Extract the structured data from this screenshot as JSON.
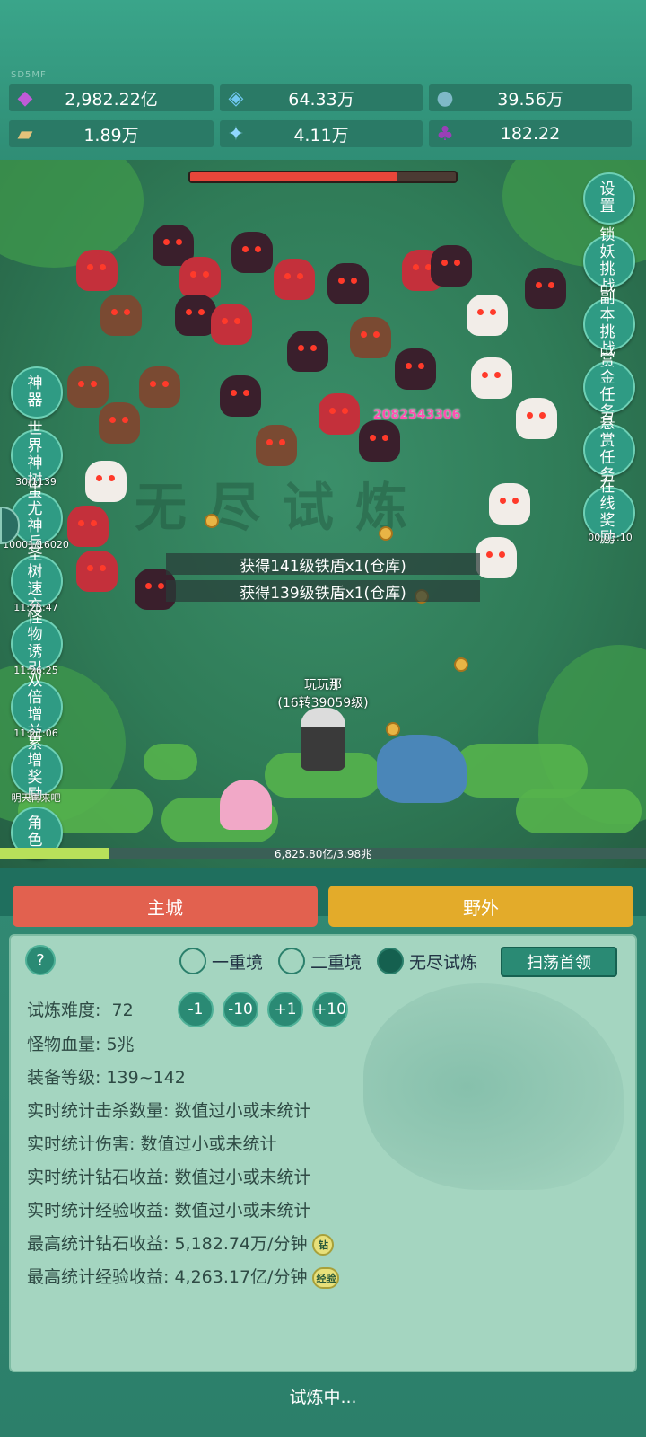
{
  "status_bar": {
    "ping": "SD5MF"
  },
  "resources": [
    {
      "icon": "purple-gem-icon",
      "value": "2,982.22亿"
    },
    {
      "icon": "blue-crystal-icon",
      "value": "64.33万"
    },
    {
      "icon": "orb-icon",
      "value": "39.56万"
    },
    {
      "icon": "scroll-icon",
      "value": "1.89万"
    },
    {
      "icon": "ice-shard-icon",
      "value": "4.11万"
    },
    {
      "icon": "potion-icon",
      "value": "182.22"
    }
  ],
  "battle": {
    "damage_number": "2082543306",
    "loot_messages": [
      "获得141级铁盾x1(仓库)",
      "获得139级铁盾x1(仓库)"
    ],
    "watermark": "无尽试炼",
    "player_name": "玩玩那",
    "player_level": "(16转39059级)",
    "boss_hp_fraction": 0.78,
    "exp_text": "6,825.80亿/3.98兆",
    "exp_fraction": 0.17
  },
  "left_buttons": [
    {
      "label": "神器",
      "timer": ""
    },
    {
      "label": "世界神树",
      "timer": "30/1139"
    },
    {
      "label": "蚩尤神兵",
      "timer": "10001/16020"
    },
    {
      "label": "圣树速充",
      "timer": "11:25:47"
    },
    {
      "label": "怪物诱引",
      "timer": "11:26:25"
    },
    {
      "label": "双倍增益",
      "timer": "11:27:06"
    },
    {
      "label": "累增奖励",
      "timer": "明天再来吧"
    },
    {
      "label": "角色",
      "timer": ""
    }
  ],
  "right_buttons": [
    {
      "label": "设置",
      "timer": ""
    },
    {
      "label": "锁妖挑战",
      "timer": ""
    },
    {
      "label": "副本挑战",
      "timer": ""
    },
    {
      "label": "赏金任务",
      "timer": ""
    },
    {
      "label": "悬赏任务",
      "timer": ""
    },
    {
      "label": "在线奖励",
      "timer": "00:03:10"
    }
  ],
  "tabs": {
    "main_city": "主城",
    "wild": "野外"
  },
  "colors": {
    "main_city": "#e2614f",
    "wild": "#e3ab2a"
  },
  "panel": {
    "help": "?",
    "modes": [
      "一重境",
      "二重境",
      "无尽试炼"
    ],
    "selected_mode": "无尽试炼",
    "sweep_button": "扫荡首领",
    "difficulty_label": "试炼难度:",
    "difficulty_value": "72",
    "adjust_buttons": [
      "-1",
      "-10",
      "+1",
      "+10"
    ],
    "lines": [
      "怪物血量:  5兆",
      "装备等级:  139~142",
      "实时统计击杀数量:  数值过小或未统计",
      "实时统计伤害:  数值过小或未统计",
      "实时统计钻石收益:  数值过小或未统计",
      "实时统计经验收益:  数值过小或未统计"
    ],
    "best_diamond": "最高统计钻石收益:  5,182.74万/分钟",
    "best_diamond_badge": "钻",
    "best_exp": "最高统计经验收益:  4,263.17亿/分钟",
    "best_exp_badge": "经验",
    "status": "试炼中..."
  }
}
